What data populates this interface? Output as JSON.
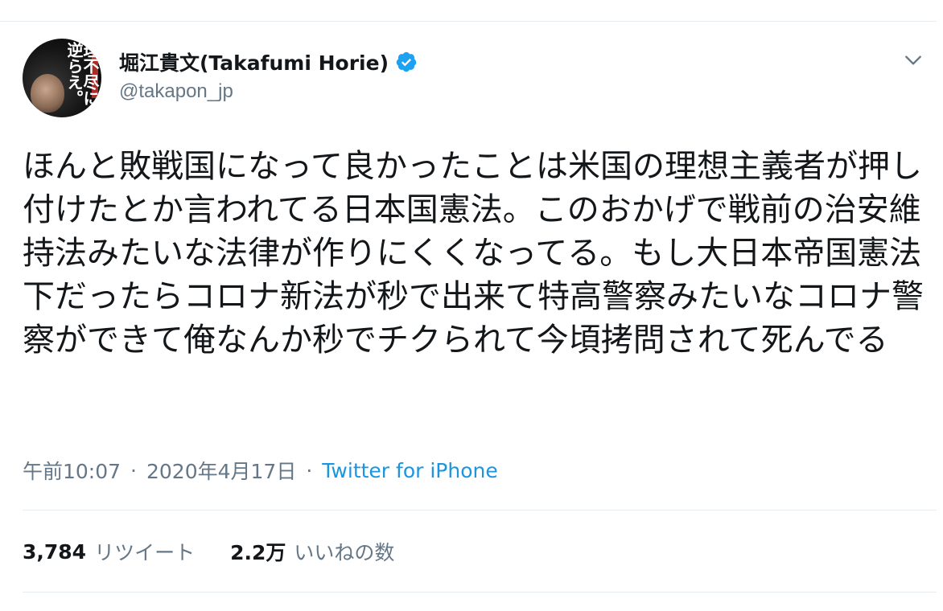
{
  "author": {
    "display_name": "堀江貴文(Takafumi Horie)",
    "handle": "@takapon_jp",
    "avatar_text": "理不尽に逆らえ。"
  },
  "tweet": {
    "text": "ほんと敗戦国になって良かったことは米国の理想主義者が押し付けたとか言われてる日本国憲法。このおかげで戦前の治安維持法みたいな法律が作りにくくなってる。もし大日本帝国憲法下だったらコロナ新法が秒で出来て特高警察みたいなコロナ警察ができて俺なんか秒でチクられて今頃拷問されて死んでる",
    "time": "午前10:07",
    "date": "2020年4月17日",
    "source": "Twitter for iPhone"
  },
  "stats": {
    "retweets": "3,784",
    "retweets_label": "リツイート",
    "likes": "2.2万",
    "likes_label": "いいねの数"
  },
  "icons": {
    "verified": "verified-badge-icon",
    "menu": "chevron-down-icon"
  },
  "colors": {
    "verified": "#1da1f2",
    "link": "#1b95e0",
    "secondary_text": "#657786",
    "divider": "#e6ecf0"
  }
}
